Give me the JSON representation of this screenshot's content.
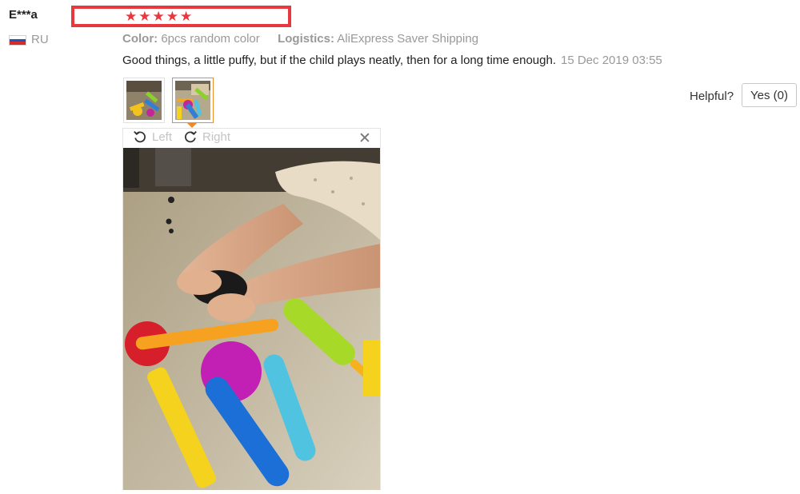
{
  "review": {
    "user": {
      "name": "E***a",
      "country": "RU",
      "flag_icon": "russia-flag-icon"
    },
    "rating": {
      "stars": 5,
      "max": 5,
      "highlight_color": "#e8383d"
    },
    "attributes": [
      {
        "label": "Color:",
        "value": "6pcs random color"
      },
      {
        "label": "Logistics:",
        "value": "AliExpress Saver Shipping"
      }
    ],
    "text": "Good things, a little puffy, but if the child plays neatly, then for a long time enough.",
    "date": "15 Dec 2019 03:55",
    "thumbnails": [
      {
        "name": "photo-thumbnail-1",
        "selected": false
      },
      {
        "name": "photo-thumbnail-2",
        "selected": true
      }
    ],
    "viewer": {
      "rotate_left_label": "Left",
      "rotate_right_label": "Right",
      "close_icon": "close-icon"
    },
    "helpful": {
      "label": "Helpful?",
      "button_label": "Yes (0)"
    }
  },
  "colors": {
    "accent": "#f08a24",
    "muted_text": "#999999"
  }
}
